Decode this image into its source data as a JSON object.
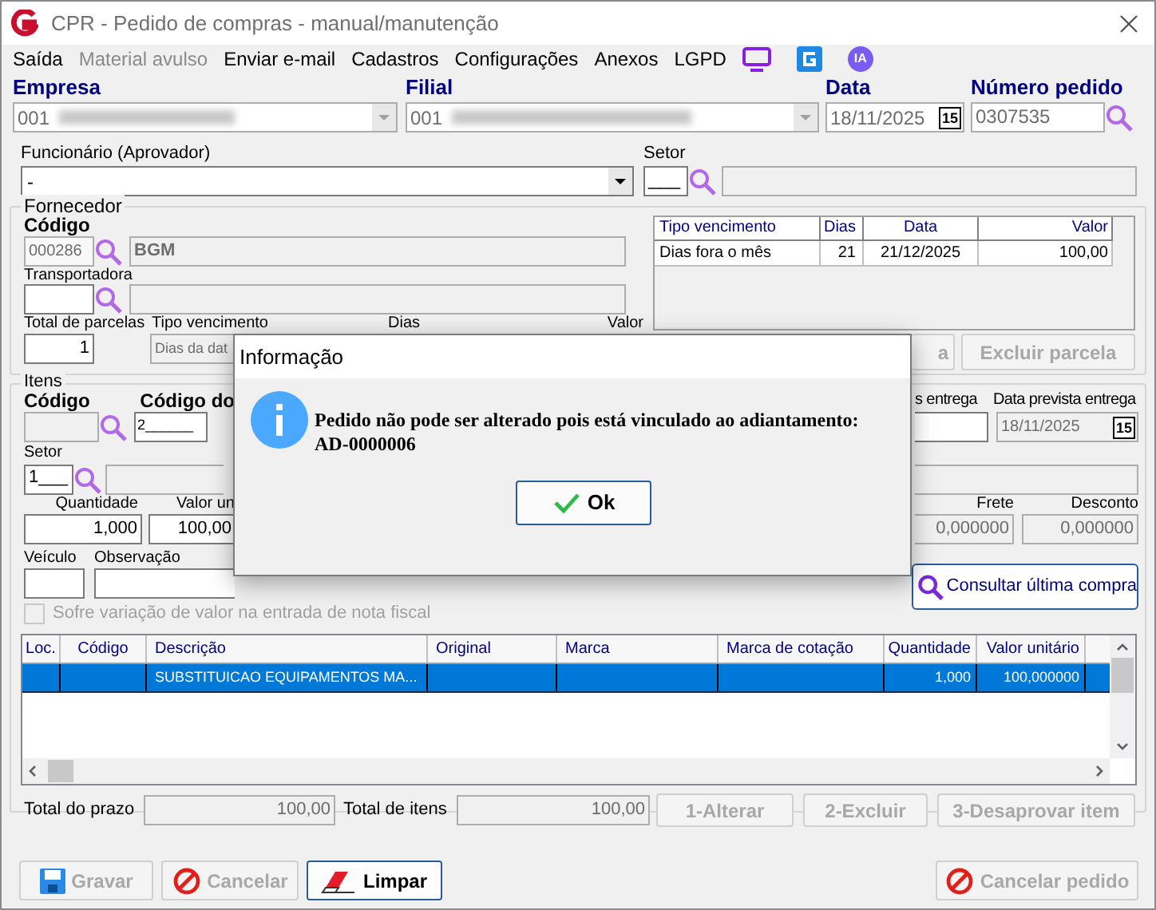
{
  "window": {
    "title": "CPR - Pedido de compras - manual/manutenção"
  },
  "menu": [
    {
      "label": "Saída",
      "disabled": false
    },
    {
      "label": "Material avulso",
      "disabled": true
    },
    {
      "label": "Enviar e-mail",
      "disabled": false
    },
    {
      "label": "Cadastros",
      "disabled": false
    },
    {
      "label": "Configurações",
      "disabled": false
    },
    {
      "label": "Anexos",
      "disabled": false
    },
    {
      "label": "LGPD",
      "disabled": false
    }
  ],
  "menu_ia_badge": "IA",
  "header": {
    "empresa": {
      "label": "Empresa",
      "value": "001"
    },
    "filial": {
      "label": "Filial",
      "value": "001"
    },
    "data": {
      "label": "Data",
      "value": "18/11/2025",
      "calendar": "15"
    },
    "numero_pedido": {
      "label": "Número pedido",
      "value": "0307535"
    },
    "funcionario": {
      "label": "Funcionário (Aprovador)",
      "value": "-"
    },
    "setor": {
      "label": "Setor",
      "value": "___"
    }
  },
  "fornecedor": {
    "title": "Fornecedor",
    "codigo_label": "Código",
    "codigo": "000286",
    "nome": "BGM",
    "transportadora_label": "Transportadora",
    "total_parcelas_label": "Total de parcelas",
    "total_parcelas": "1",
    "tipo_vencimento_label": "Tipo vencimento",
    "tipo_vencimento": "Dias da dat",
    "dias_label": "Dias",
    "valor_label": "Valor"
  },
  "parcelas": {
    "columns": [
      "Tipo vencimento",
      "Dias",
      "Data",
      "Valor"
    ],
    "rows": [
      [
        "Dias fora o mês",
        "21",
        "21/12/2025",
        "100,00"
      ]
    ]
  },
  "parcela_buttons": [
    {
      "label": "a",
      "disabled": true
    },
    {
      "label": "Excluir parcela",
      "disabled": true
    }
  ],
  "itens": {
    "title": "Itens",
    "codigo_label": "Código",
    "codigo_do_label": "Código do",
    "codigo_do": "2______",
    "entrega_label": "s entrega",
    "data_prevista_label": "Data prevista entrega",
    "data_prevista": "18/11/2025",
    "calendar": "15",
    "setor_label": "Setor",
    "setor": "1___",
    "quantidade_label": "Quantidade",
    "quantidade": "1,000",
    "valor_unit_label": "Valor un",
    "valor_unit": "100,00",
    "frete_label": "Frete",
    "frete": "0,000000",
    "desconto_label": "Desconto",
    "desconto": "0,000000",
    "veiculo_label": "Veículo",
    "observacao_label": "Observação",
    "consultar_button": "Consultar última compra"
  },
  "checkbox": {
    "label": "Sofre variação de valor na entrada de nota fiscal",
    "checked": false,
    "disabled": true
  },
  "grid": {
    "columns": [
      "Loc.",
      "Código",
      "Descrição",
      "Original",
      "Marca",
      "Marca de cotação",
      "Quantidade",
      "Valor unitário"
    ],
    "rows": [
      {
        "cells": [
          "",
          "",
          "SUBSTITUICAO EQUIPAMENTOS MA...",
          "",
          "",
          "",
          "1,000",
          "100,000000"
        ],
        "selected": true
      }
    ]
  },
  "totals": {
    "prazo_label": "Total do prazo",
    "prazo": "100,00",
    "itens_label": "Total de itens",
    "itens": "100,00"
  },
  "item_buttons": [
    {
      "label": "1-Alterar",
      "disabled": true
    },
    {
      "label": "2-Excluir",
      "disabled": true
    },
    {
      "label": "3-Desaprovar item",
      "disabled": true
    }
  ],
  "footer_buttons": [
    {
      "label": "Gravar",
      "kind": "save",
      "disabled": true
    },
    {
      "label": "Cancelar",
      "kind": "cancel",
      "disabled": true
    },
    {
      "label": "Limpar",
      "kind": "clear",
      "disabled": false
    },
    {
      "label": "Cancelar pedido",
      "kind": "cancel",
      "disabled": true
    }
  ],
  "dialog": {
    "title": "Informação",
    "message": "Pedido não pode ser alterado pois está vinculado ao adiantamento: AD-0000006",
    "button": "Ok"
  }
}
